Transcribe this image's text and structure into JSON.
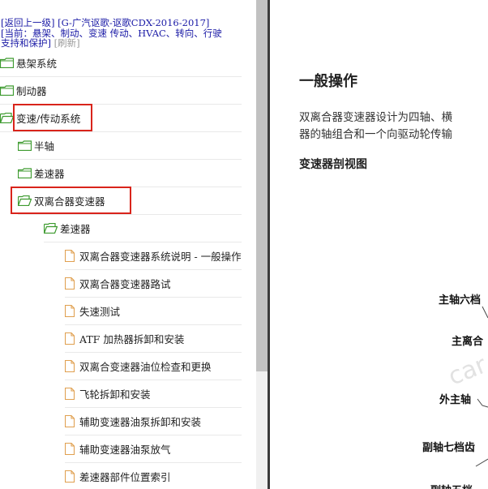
{
  "nav": {
    "back_link": "[返回上一级]",
    "vehicle": "[G-广汽讴歌-讴歌CDX-2016-2017]",
    "current_line1": "[当前：悬架、制动、变速 传动、HVAC、转向、行驶",
    "current_line2": "支持和保护]",
    "refresh": "[刷新]"
  },
  "tree": [
    {
      "label": "悬架系统",
      "kind": "folder",
      "open": false
    },
    {
      "label": "制动器",
      "kind": "folder",
      "open": false
    },
    {
      "label": "变速/传动系统",
      "kind": "folder",
      "open": true,
      "highlighted": true
    },
    {
      "label": "半轴",
      "kind": "folder",
      "open": false
    },
    {
      "label": "差速器",
      "kind": "folder",
      "open": false
    },
    {
      "label": "双离合器变速器",
      "kind": "folder",
      "open": true,
      "highlighted": true
    },
    {
      "label": "差速器",
      "kind": "folder",
      "open": true
    },
    {
      "label": "双离合器变速器系统说明 - 一般操作",
      "kind": "doc"
    },
    {
      "label": "双离合器变速器路试",
      "kind": "doc"
    },
    {
      "label": "失速测试",
      "kind": "doc"
    },
    {
      "label": "ATF 加热器拆卸和安装",
      "kind": "doc"
    },
    {
      "label": "双离合变速器油位检查和更换",
      "kind": "doc"
    },
    {
      "label": "飞轮拆卸和安装",
      "kind": "doc"
    },
    {
      "label": "辅助变速器油泵拆卸和安装",
      "kind": "doc"
    },
    {
      "label": "辅助变速器油泵放气",
      "kind": "doc"
    },
    {
      "label": "差速器部件位置索引",
      "kind": "doc"
    }
  ],
  "content": {
    "title": "一般操作",
    "para_line1": "双离合器变速器设计为四轴、横",
    "para_line2": "器的轴组合和一个向驱动轮传输",
    "section_title": "变速器剖视图",
    "watermark": "car",
    "diagram_labels": [
      "主轴六档",
      "主离合",
      "外主轴",
      "副轴七档齿",
      "副轴五档"
    ]
  },
  "colors": {
    "highlight_box": "#d9241b",
    "link": "#1a1aa6",
    "folder_green": "#3c9a2e",
    "doc_orange": "#e0a050"
  }
}
